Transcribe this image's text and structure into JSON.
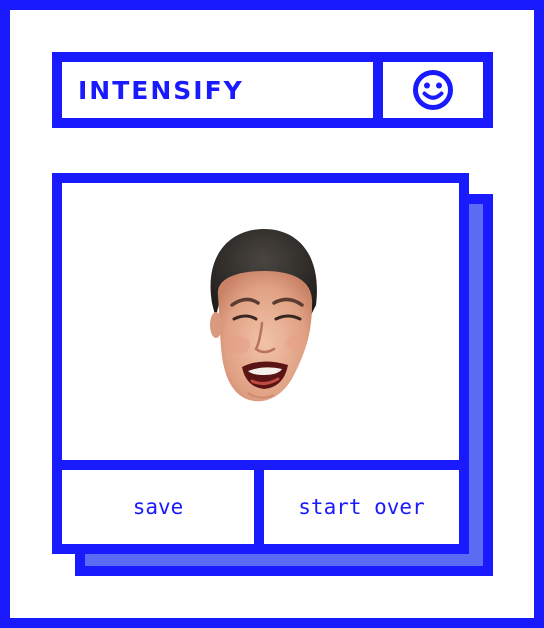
{
  "app": {
    "title": "INTENSIFY"
  },
  "header": {
    "icon": "smiley-face-icon"
  },
  "canvas": {
    "image": "crying-face-cutout"
  },
  "actions": {
    "save_label": "save",
    "start_over_label": "start over"
  },
  "colors": {
    "accent": "#1a1aff",
    "shadow": "#5a6cf2",
    "background": "#ffffff"
  }
}
